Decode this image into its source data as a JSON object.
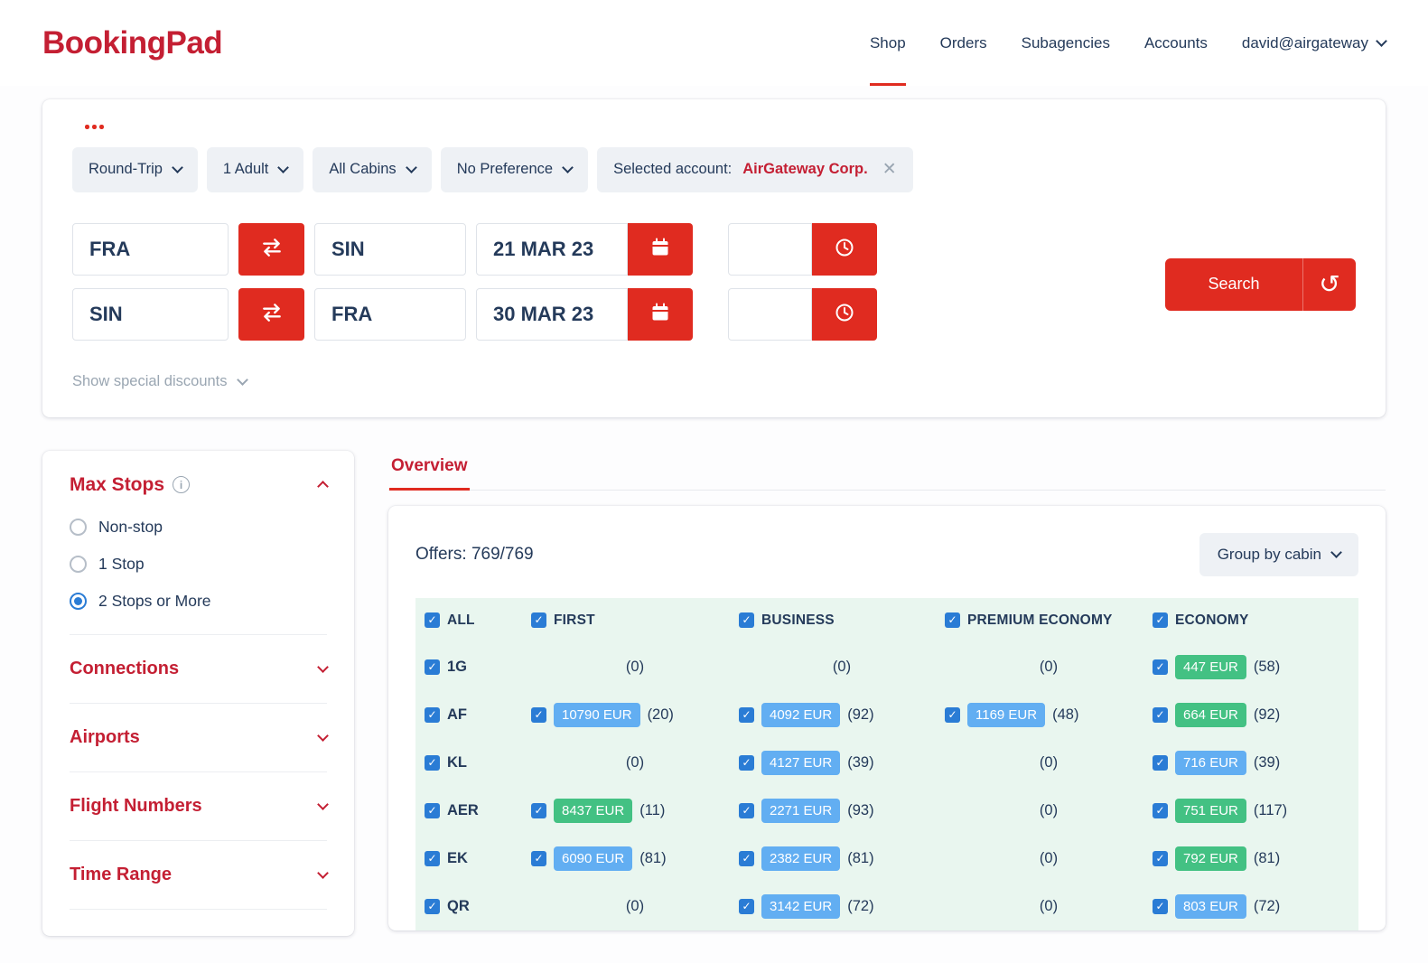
{
  "colors": {
    "brand_red": "#c41f33",
    "button_red": "#e02b20",
    "accent_blue": "#2a7cd5",
    "badge_blue": "#62aef2",
    "badge_green": "#43c183",
    "table_bg": "#e9f6ef",
    "text_dark": "#243a5a"
  },
  "header": {
    "logo": "BookingPad",
    "nav": [
      {
        "label": "Shop",
        "active": true
      },
      {
        "label": "Orders",
        "active": false
      },
      {
        "label": "Subagencies",
        "active": false
      },
      {
        "label": "Accounts",
        "active": false
      }
    ],
    "user_menu": "david@airgateway"
  },
  "search_panel": {
    "trip_type": "Round-Trip",
    "passengers": "1 Adult",
    "cabins": "All Cabins",
    "preference": "No Preference",
    "selected_account_label": "Selected account:",
    "selected_account_value": "AirGateway Corp.",
    "legs": [
      {
        "origin": "FRA",
        "destination": "SIN",
        "date": "21 MAR 23",
        "time": ""
      },
      {
        "origin": "SIN",
        "destination": "FRA",
        "date": "30 MAR 23",
        "time": ""
      }
    ],
    "search_button": "Search",
    "discounts_link": "Show special discounts"
  },
  "filters": {
    "max_stops_title": "Max Stops",
    "max_stops_options": [
      {
        "label": "Non-stop",
        "selected": false
      },
      {
        "label": "1 Stop",
        "selected": false
      },
      {
        "label": "2 Stops or More",
        "selected": true
      }
    ],
    "sections": [
      {
        "label": "Connections"
      },
      {
        "label": "Airports"
      },
      {
        "label": "Flight Numbers"
      },
      {
        "label": "Time Range"
      }
    ]
  },
  "results": {
    "tab_label": "Overview",
    "offers_count": "Offers: 769/769",
    "group_by_label": "Group by cabin",
    "table": {
      "columns": [
        "ALL",
        "FIRST",
        "BUSINESS",
        "PREMIUM ECONOMY",
        "ECONOMY"
      ],
      "rows": [
        {
          "airline": "1G",
          "cells": [
            {
              "count": "(0)"
            },
            {
              "count": "(0)"
            },
            {
              "count": "(0)"
            },
            {
              "price": "447 EUR",
              "count": "(58)",
              "style": "green",
              "checked": true
            }
          ]
        },
        {
          "airline": "AF",
          "cells": [
            {
              "price": "10790 EUR",
              "count": "(20)",
              "style": "blue",
              "checked": true
            },
            {
              "price": "4092 EUR",
              "count": "(92)",
              "style": "blue",
              "checked": true
            },
            {
              "price": "1169 EUR",
              "count": "(48)",
              "style": "blue",
              "checked": true
            },
            {
              "price": "664 EUR",
              "count": "(92)",
              "style": "green",
              "checked": true
            }
          ]
        },
        {
          "airline": "KL",
          "cells": [
            {
              "count": "(0)"
            },
            {
              "price": "4127 EUR",
              "count": "(39)",
              "style": "blue",
              "checked": true
            },
            {
              "count": "(0)"
            },
            {
              "price": "716 EUR",
              "count": "(39)",
              "style": "blue",
              "checked": true
            }
          ]
        },
        {
          "airline": "AER",
          "cells": [
            {
              "price": "8437 EUR",
              "count": "(11)",
              "style": "green",
              "checked": true
            },
            {
              "price": "2271 EUR",
              "count": "(93)",
              "style": "blue",
              "checked": true
            },
            {
              "count": "(0)"
            },
            {
              "price": "751 EUR",
              "count": "(117)",
              "style": "green",
              "checked": true
            }
          ]
        },
        {
          "airline": "EK",
          "cells": [
            {
              "price": "6090 EUR",
              "count": "(81)",
              "style": "blue",
              "checked": true
            },
            {
              "price": "2382 EUR",
              "count": "(81)",
              "style": "blue",
              "checked": true
            },
            {
              "count": "(0)"
            },
            {
              "price": "792 EUR",
              "count": "(81)",
              "style": "green",
              "checked": true
            }
          ]
        },
        {
          "airline": "QR",
          "cells": [
            {
              "count": "(0)"
            },
            {
              "price": "3142 EUR",
              "count": "(72)",
              "style": "blue",
              "checked": true
            },
            {
              "count": "(0)"
            },
            {
              "price": "803 EUR",
              "count": "(72)",
              "style": "blue",
              "checked": true
            }
          ]
        }
      ]
    }
  }
}
